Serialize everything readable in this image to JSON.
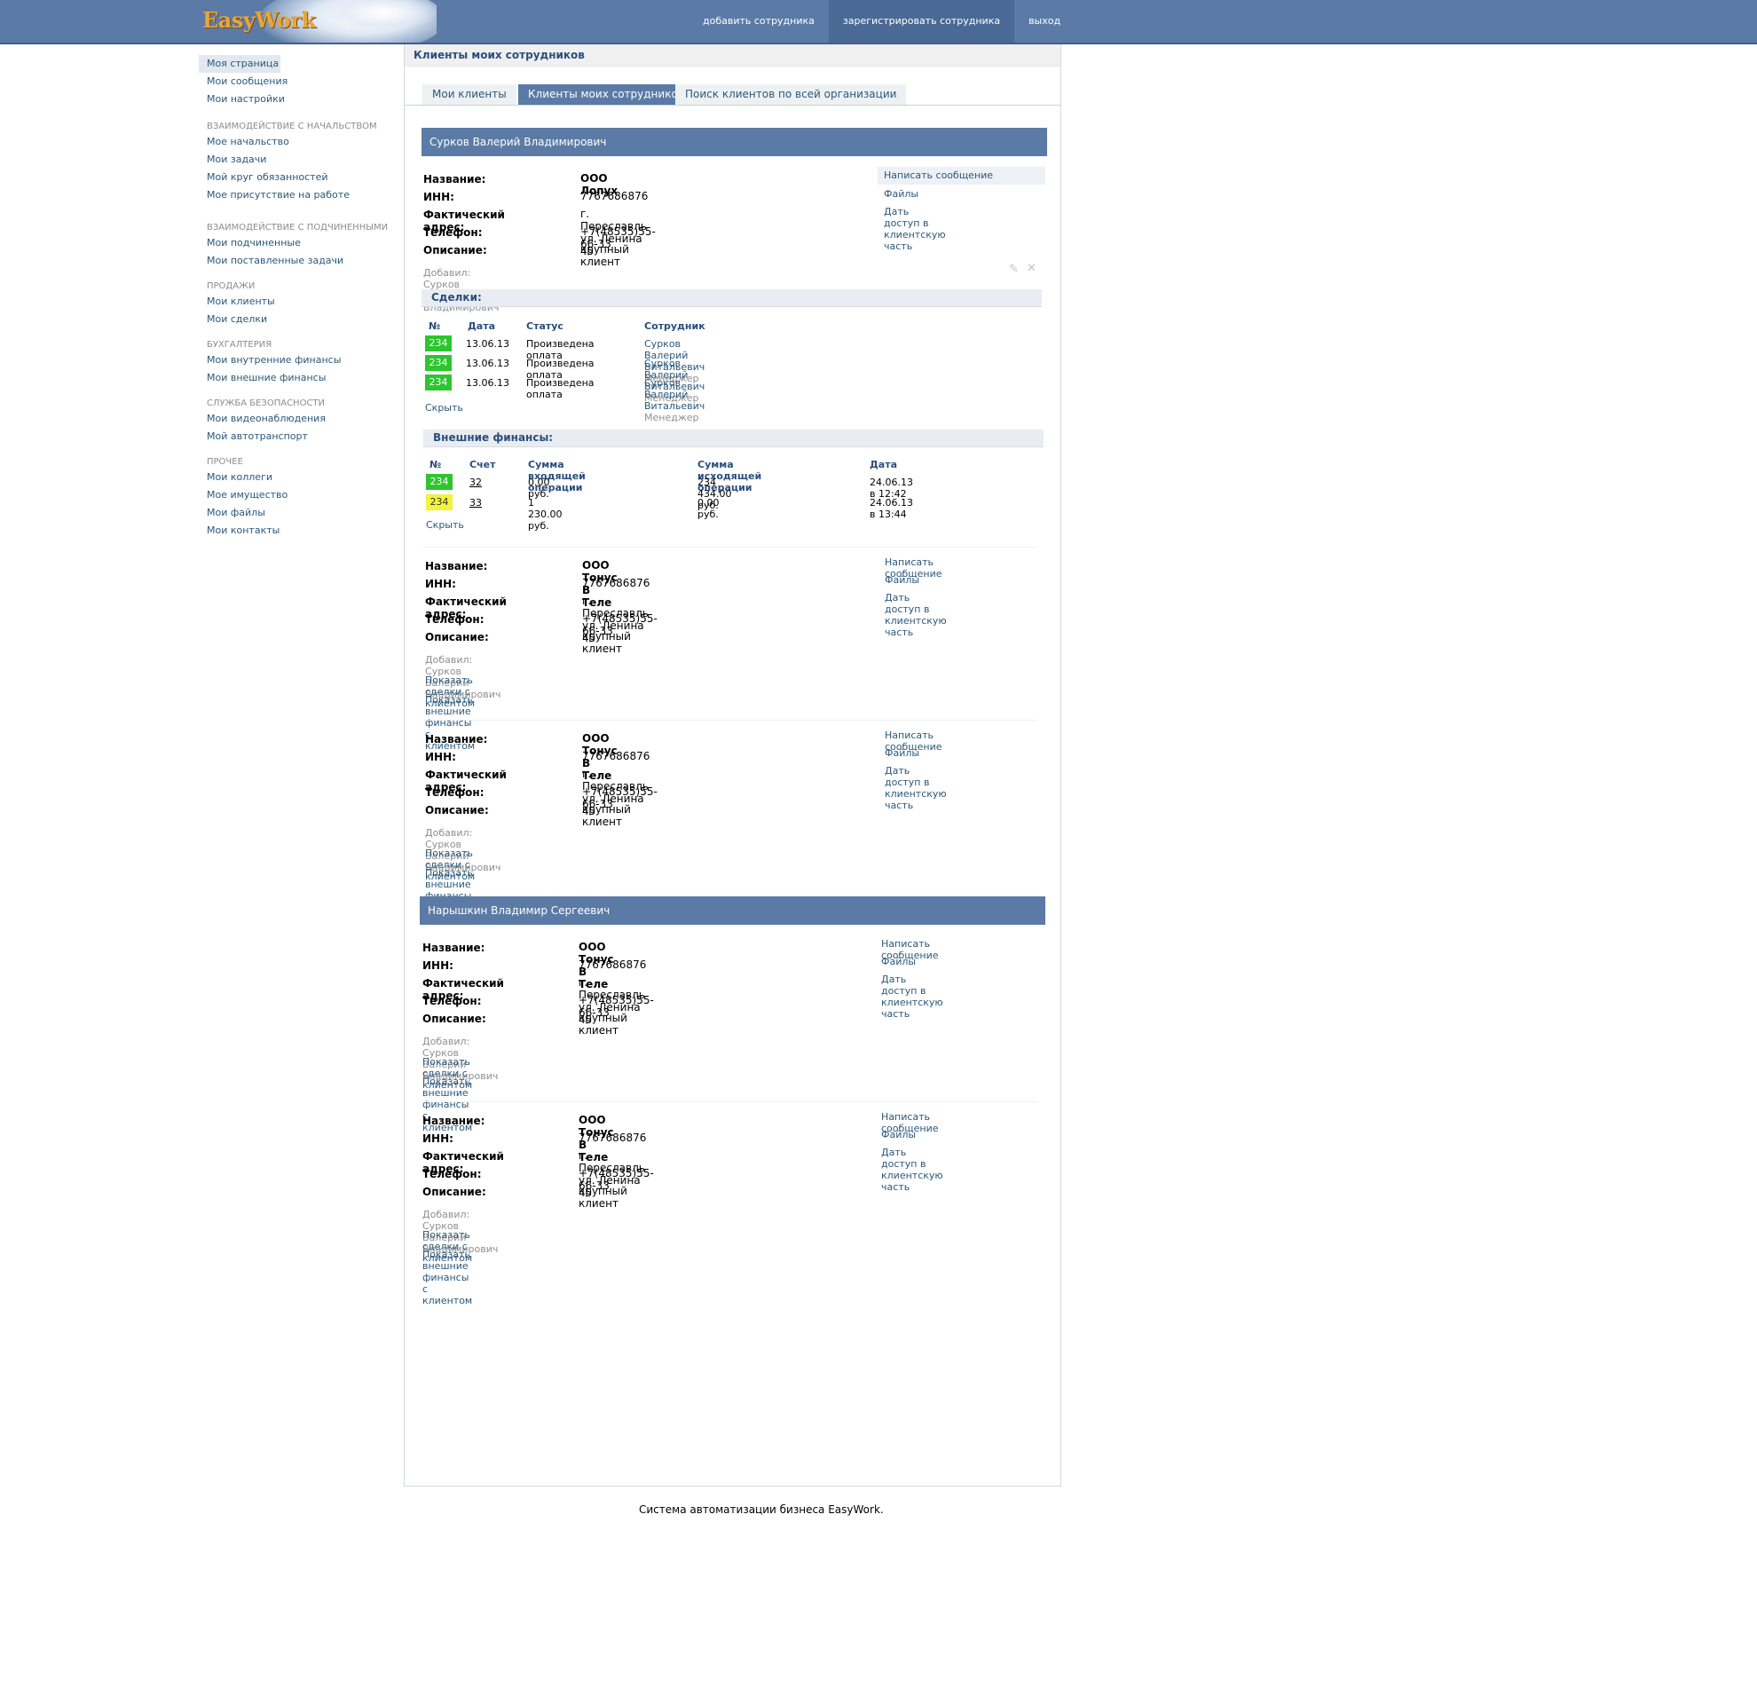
{
  "header": {
    "logo": "EasyWork",
    "nav": [
      "добавить сотрудника",
      "зарегистрировать сотрудника",
      "выход"
    ]
  },
  "sidebar": {
    "top": [
      "Моя страница",
      "Мои сообщения",
      "Мои настройки"
    ],
    "groups": [
      {
        "title": "Взаимодействие с начальством",
        "items": [
          "Мое начальство",
          "Мои задачи",
          "Мой круг обязанностей",
          "Мое присутствие на работе"
        ]
      },
      {
        "title": "Взаимодействие с подчиненными",
        "items": [
          "Мои подчиненные",
          "Мои поставленные задачи"
        ]
      },
      {
        "title": "Продажи",
        "items": [
          "Мои клиенты",
          "Мои сделки"
        ]
      },
      {
        "title": "Бухгалтерия",
        "items": [
          "Мои внутренние финансы",
          "Мои внешние финансы"
        ]
      },
      {
        "title": "Служба безопасности",
        "items": [
          "Мои видеонаблюдения",
          "Мой автотранспорт"
        ]
      },
      {
        "title": "Прочее",
        "items": [
          "Мои коллеги",
          "Мое имущество",
          "Мои файлы",
          "Мои контакты"
        ]
      }
    ]
  },
  "page": {
    "title": "Клиенты моих сотрудников",
    "tabs": [
      "Мои клиенты",
      "Клиенты моих сотрудников",
      "Поиск клиентов по всей организации"
    ]
  },
  "labels": {
    "name": "Название:",
    "inn": "ИНН:",
    "address": "Фактический адрес:",
    "phone": "Телефон:",
    "description": "Описание:",
    "added_by_prefix": "Добавил:",
    "write_message": "Написать сообщение",
    "files": "Файлы",
    "give_access": "Дать доступ в клиентскую часть",
    "show_deals": "Показать сделки с клиентом",
    "show_finances": "Показать внешние финансы с клиентом",
    "hide": "Скрыть",
    "deals_title": "Сделки:",
    "finances_title": "Внешние финансы:"
  },
  "employees": [
    {
      "name": "Сурков Валерий Владимирович",
      "clients": [
        {
          "name": "ООО Лопух",
          "inn": "7767686876",
          "address": "г. Переславль ул. Ленина 45",
          "phone": "+7(48535)55-66-33",
          "description": "крупный клиент",
          "added_by": "Сурков Валерий Владимирович"
        },
        {
          "name": "ООО Тонус В Теле",
          "inn": "7767686876",
          "address": "г. Переславль ул. Ленина 45",
          "phone": "+7(48535)55-66-33",
          "description": "крупный клиент",
          "added_by": "Сурков Валерий Владимирович"
        },
        {
          "name": "ООО Тонус В Теле",
          "inn": "7767686876",
          "address": "г. Переславль ул. Ленина 45",
          "phone": "+7(48535)55-66-33",
          "description": "крупный клиент",
          "added_by": "Сурков Валерий Владимирович"
        }
      ]
    },
    {
      "name": "Нарышкин Владимир Сергеевич",
      "clients": [
        {
          "name": "ООО Тонус В Теле",
          "inn": "7767686876",
          "address": "г. Переславль ул. Ленина 45",
          "phone": "+7(48535)55-66-33",
          "description": "крупный клиент",
          "added_by": "Сурков Валерий Владимирович"
        },
        {
          "name": "ООО Тонус В Теле",
          "inn": "7767686876",
          "address": "г. Переславль ул. Ленина 45",
          "phone": "+7(48535)55-66-33",
          "description": "крупный клиент",
          "added_by": "Сурков Валерий Владимирович"
        }
      ]
    }
  ],
  "deals": {
    "columns": [
      "№",
      "Дата",
      "Статус",
      "Сотрудник"
    ],
    "rows": [
      {
        "num": "234",
        "date": "13.06.13",
        "status": "Произведена оплата",
        "employee": "Сурков Валерий Витальевич",
        "role": "Менеджер"
      },
      {
        "num": "234",
        "date": "13.06.13",
        "status": "Произведена оплата",
        "employee": "Сурков Валерий Витальевич",
        "role": "Менеджер"
      },
      {
        "num": "234",
        "date": "13.06.13",
        "status": "Произведена оплата",
        "employee": "Сурков Валерий Витальевич",
        "role": "Менеджер"
      }
    ]
  },
  "finances": {
    "columns": [
      "№",
      "Счет",
      "Сумма входящей операции",
      "Сумма исходящей операции",
      "Дата"
    ],
    "rows": [
      {
        "num": "234",
        "account": "32",
        "incoming": "0.00 руб.",
        "outgoing": "234 434.00 руб.",
        "date": "24.06.13 в 12:42",
        "color": "green"
      },
      {
        "num": "234",
        "account": "33",
        "incoming": "1 230.00 руб.",
        "outgoing": "0.00 руб.",
        "date": "24.06.13 в 13:44",
        "color": "yellow"
      }
    ]
  },
  "colors": {
    "header": "#5b7ba6",
    "link": "#2b587a",
    "badge_green": "#2ec52e",
    "badge_yellow": "#f4f23a"
  },
  "footer": "Система автоматизации бизнеса EasyWork."
}
